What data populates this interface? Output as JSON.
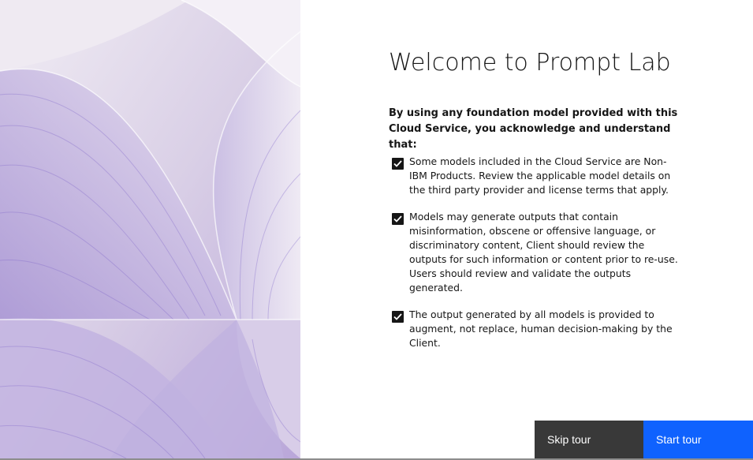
{
  "modal": {
    "title": "Welcome to Prompt Lab",
    "intro": "By using any foundation model provided with this Cloud Service, you acknowledge and understand that:",
    "items": [
      {
        "text": "Some models included in the Cloud Service are Non-IBM Products. Review the applicable model details on the third party provider and license terms that apply.",
        "checked": true
      },
      {
        "text": "Models may generate outputs that contain misinformation, obscene or offensive language, or discriminatory content, Client should review the outputs for such information or content prior to re-use. Users should review and validate the outputs generated.",
        "checked": true
      },
      {
        "text": "The output generated by all models is provided to augment, not replace, human decision-making by the Client.",
        "checked": true
      }
    ],
    "buttons": {
      "skip_label": "Skip tour",
      "start_label": "Start tour"
    }
  },
  "colors": {
    "primary": "#0f62fe",
    "secondary": "#393939",
    "text": "#161616",
    "art_base": "#e9e2ef",
    "art_accent": "#8a6fd1"
  },
  "icons": {
    "checkbox": "checkmark-icon",
    "art": "abstract-curves-illustration"
  }
}
